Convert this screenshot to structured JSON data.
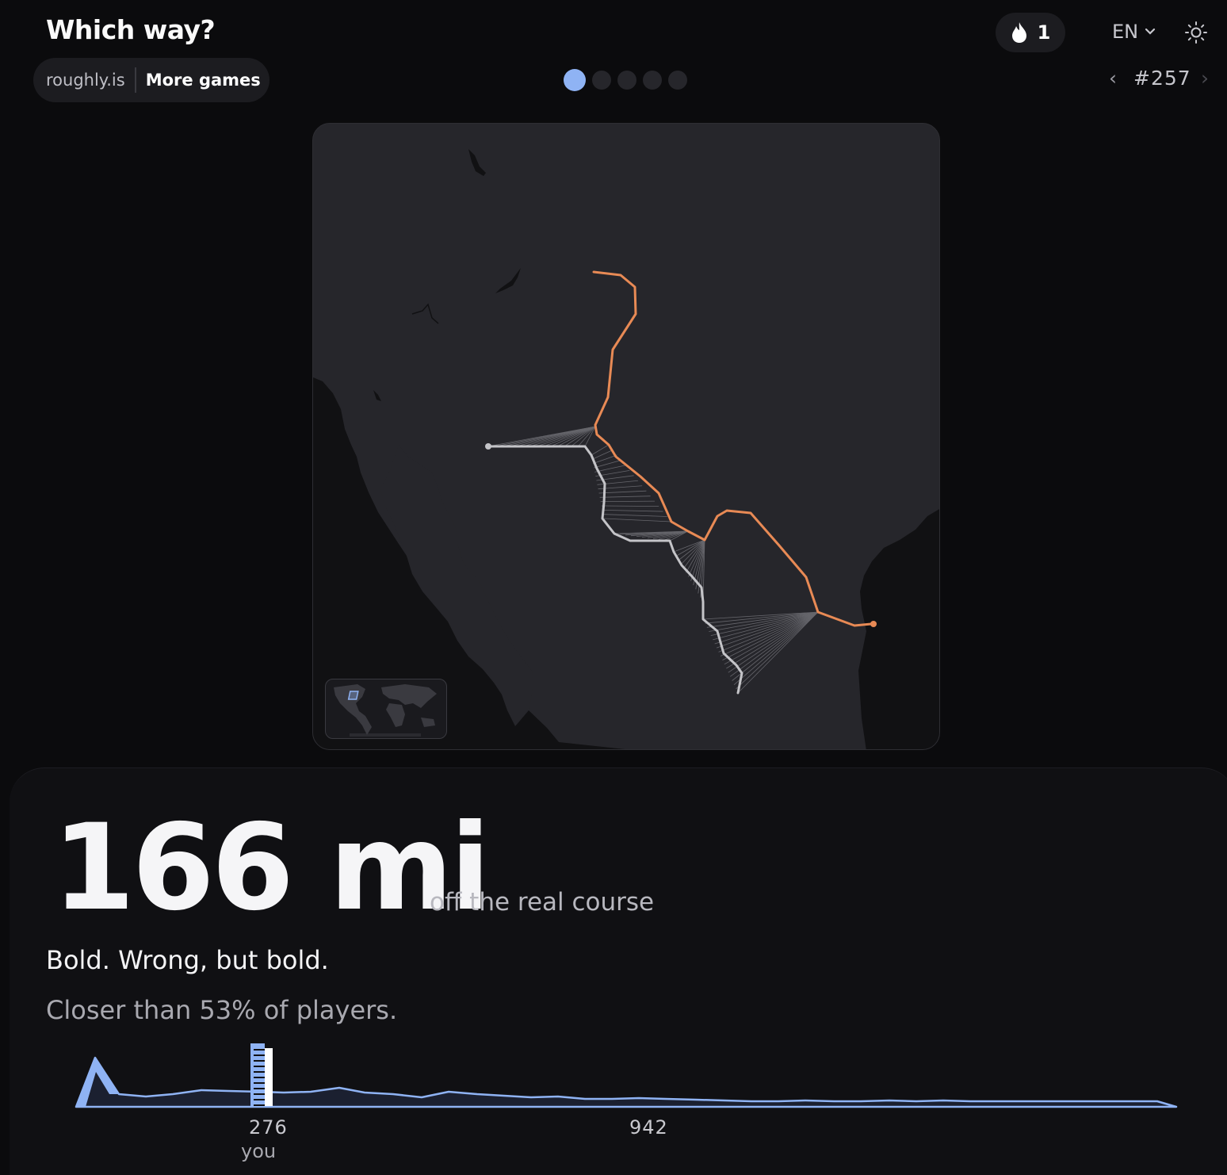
{
  "header": {
    "title": "Which way?",
    "site": "roughly.is",
    "more_games": "More games",
    "streak": "1",
    "language": "EN",
    "prev": "‹",
    "puzzle_number": "#257",
    "next": "›"
  },
  "progress": {
    "total": 5,
    "current": 1
  },
  "colors": {
    "accent_blue": "#8fb3f4",
    "real_route": "#e88a55",
    "guess_route": "#c4c4c8",
    "land": "#26262b",
    "sea": "#111113"
  },
  "result": {
    "distance": "166 mi",
    "distance_caption": "off the real course",
    "verdict": "Bold. Wrong, but bold.",
    "percentile_text": "Closer than 53% of players."
  },
  "chart_data": {
    "type": "area",
    "x_ticks": [
      "276",
      "942"
    ],
    "marker_label": "you",
    "marker_value": 276
  }
}
